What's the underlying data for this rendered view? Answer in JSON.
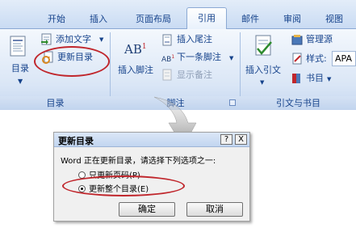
{
  "tabs": [
    {
      "label": "开始"
    },
    {
      "label": "插入"
    },
    {
      "label": "页面布局"
    },
    {
      "label": "引用"
    },
    {
      "label": "邮件"
    },
    {
      "label": "审阅"
    },
    {
      "label": "视图"
    }
  ],
  "active_tab": "引用",
  "groups": {
    "toc": {
      "label": "目录",
      "toc_button": "目录",
      "add_text": "添加文字",
      "update_toc": "更新目录"
    },
    "footnotes": {
      "label": "脚注",
      "insert_footnote": "插入脚注",
      "insert_endnote": "插入尾注",
      "next_footnote": "下一条脚注",
      "show_notes": "显示备注",
      "footnote_icon_text": "AB"
    },
    "citations": {
      "label": "引文与书目",
      "insert_citation": "插入引文",
      "manage_sources": "管理源",
      "style_label": "样式:",
      "style_value": "APA",
      "bibliography": "书目"
    }
  },
  "dialog": {
    "title": "更新目录",
    "help_button": "?",
    "close_button": "X",
    "prompt": "Word 正在更新目录，请选择下列选项之一:",
    "options": [
      {
        "label": "只更新页码(P)",
        "selected": false
      },
      {
        "label": "更新整个目录(E)",
        "selected": true
      }
    ],
    "ok": "确定",
    "cancel": "取消"
  },
  "colors": {
    "highlight_ellipse": "#c0262c",
    "ribbon_text": "#15428b"
  }
}
